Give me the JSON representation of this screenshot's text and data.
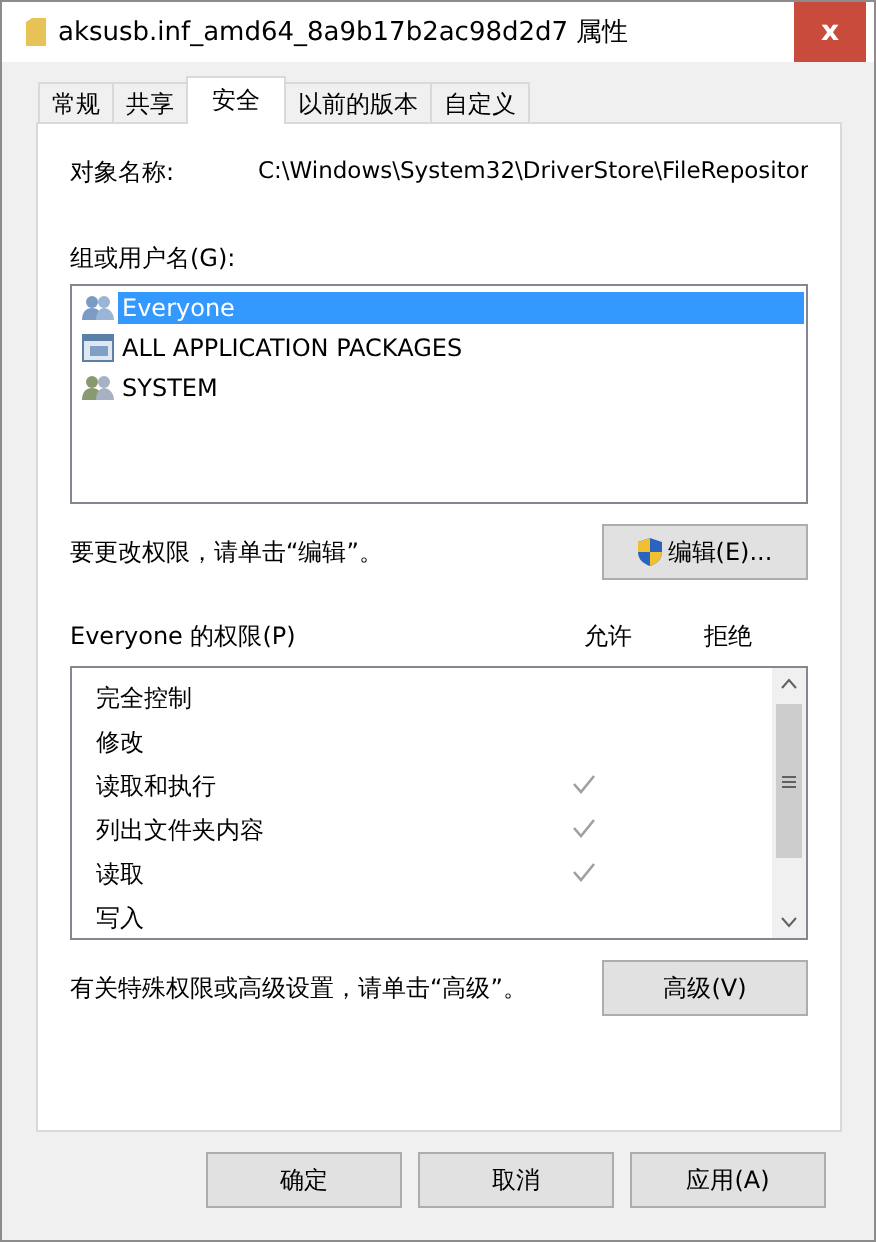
{
  "window": {
    "title": "aksusb.inf_amd64_8a9b17b2ac98d2d7 属性",
    "close": "x"
  },
  "tabs": [
    {
      "label": "常规",
      "selected": false
    },
    {
      "label": "共享",
      "selected": false
    },
    {
      "label": "安全",
      "selected": true
    },
    {
      "label": "以前的版本",
      "selected": false
    },
    {
      "label": "自定义",
      "selected": false
    }
  ],
  "object_name": {
    "label": "对象名称:",
    "value": "C:\\Windows\\System32\\DriverStore\\FileRepositor"
  },
  "groups": {
    "label": "组或用户名(G):",
    "items": [
      {
        "name": "Everyone",
        "kind": "group",
        "selected": true
      },
      {
        "name": "ALL APPLICATION PACKAGES",
        "kind": "package",
        "selected": false
      },
      {
        "name": "SYSTEM",
        "kind": "group",
        "selected": false
      }
    ]
  },
  "edit_hint": "要更改权限，请单击“编辑”。",
  "edit_button": "编辑(E)...",
  "permissions": {
    "title": "Everyone 的权限(P)",
    "allow_header": "允许",
    "deny_header": "拒绝",
    "rows": [
      {
        "name": "完全控制",
        "allow": false,
        "deny": false
      },
      {
        "name": "修改",
        "allow": false,
        "deny": false
      },
      {
        "name": "读取和执行",
        "allow": true,
        "deny": false
      },
      {
        "name": "列出文件夹内容",
        "allow": true,
        "deny": false
      },
      {
        "name": "读取",
        "allow": true,
        "deny": false
      },
      {
        "name": "写入",
        "allow": false,
        "deny": false
      }
    ]
  },
  "advanced_hint": "有关特殊权限或高级设置，请单击“高级”。",
  "advanced_button": "高级(V)",
  "buttons": [
    "确定",
    "取消",
    "应用(A)"
  ]
}
